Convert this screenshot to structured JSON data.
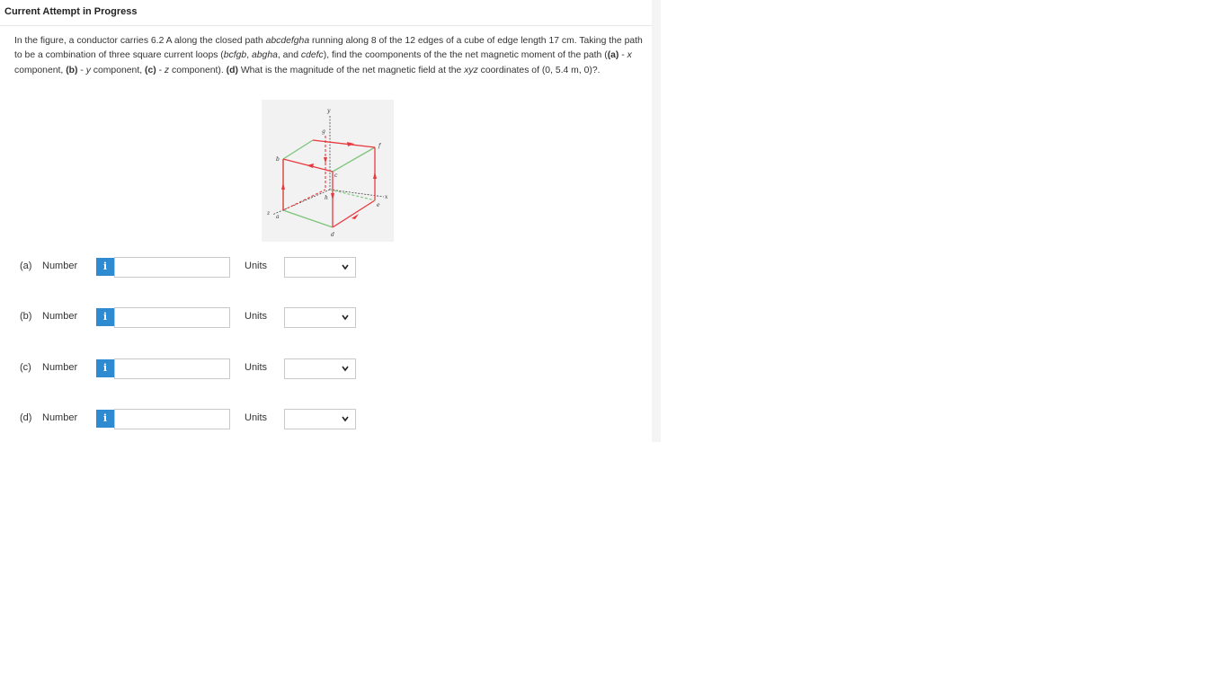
{
  "header": {
    "title": "Current Attempt in Progress"
  },
  "question": {
    "p1": "In the figure, a conductor carries 6.2 A along the closed path ",
    "path": "abcdefgha",
    "p2": " running along 8 of the 12 edges of a cube of edge length 17 cm. Taking the path to be a combination of three square current loops (",
    "loop1": "bcfgb",
    "sep1": ", ",
    "loop2": "abgha",
    "sep2": ", and ",
    "loop3": "cdefc",
    "p3": "), find the coomponents of the the net magnetic moment of the path (",
    "a_tag": "(a)",
    "a_text": " - ",
    "a_var": "x",
    "a_end": " component, ",
    "b_tag": "(b)",
    "b_text": " - ",
    "b_var": "y",
    "b_end": " component, ",
    "c_tag": "(c)",
    "c_text": " - ",
    "c_var": "z",
    "c_end": " component). ",
    "d_tag": "(d)",
    "d_text": " What is the magnitude of the net magnetic field at the ",
    "d_var": "xyz",
    "d_end": " coordinates of (0, 5.4 m, 0)?."
  },
  "figure": {
    "labels": {
      "y": "y",
      "x": "x",
      "z": "z",
      "a": "a",
      "b": "b",
      "c": "c",
      "d": "d",
      "e": "e",
      "f": "f",
      "g": "g",
      "h": "h"
    },
    "colors": {
      "current_path": "#e8393f",
      "other_edges": "#7cc47a",
      "axes": "#333333"
    }
  },
  "answers": [
    {
      "part": "(a)",
      "number_label": "Number",
      "info": "i",
      "value": "",
      "units_label": "Units",
      "units_value": ""
    },
    {
      "part": "(b)",
      "number_label": "Number",
      "info": "i",
      "value": "",
      "units_label": "Units",
      "units_value": ""
    },
    {
      "part": "(c)",
      "number_label": "Number",
      "info": "i",
      "value": "",
      "units_label": "Units",
      "units_value": ""
    },
    {
      "part": "(d)",
      "number_label": "Number",
      "info": "i",
      "value": "",
      "units_label": "Units",
      "units_value": ""
    }
  ],
  "icons": {
    "info": "info-icon",
    "dropdown": "chevron-down-icon"
  },
  "colors": {
    "info_button": "#2e8bd1"
  }
}
